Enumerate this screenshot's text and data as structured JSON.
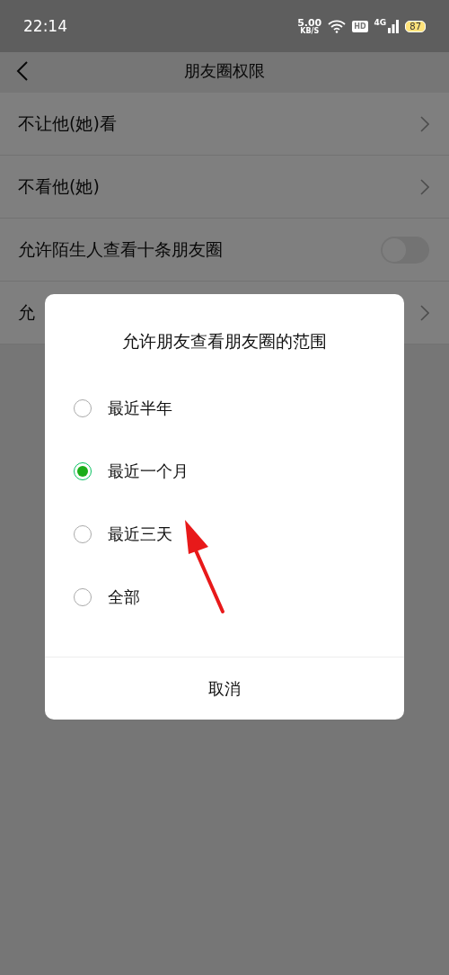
{
  "status_bar": {
    "time": "22:14",
    "net_speed": "5.00",
    "net_speed_unit": "KB/S",
    "hd": "HD",
    "network": "4G",
    "battery": "87"
  },
  "nav": {
    "title": "朋友圈权限"
  },
  "rows": [
    {
      "kind": "link",
      "label": "不让他(她)看"
    },
    {
      "kind": "link",
      "label": "不看他(她)"
    },
    {
      "kind": "toggle",
      "label": "允许陌生人查看十条朋友圈",
      "on": false
    },
    {
      "kind": "link",
      "label": "允"
    }
  ],
  "dialog": {
    "title": "允许朋友查看朋友圈的范围",
    "options": [
      {
        "label": "最近半年",
        "selected": false
      },
      {
        "label": "最近一个月",
        "selected": true
      },
      {
        "label": "最近三天",
        "selected": false
      },
      {
        "label": "全部",
        "selected": false
      }
    ],
    "cancel": "取消"
  }
}
